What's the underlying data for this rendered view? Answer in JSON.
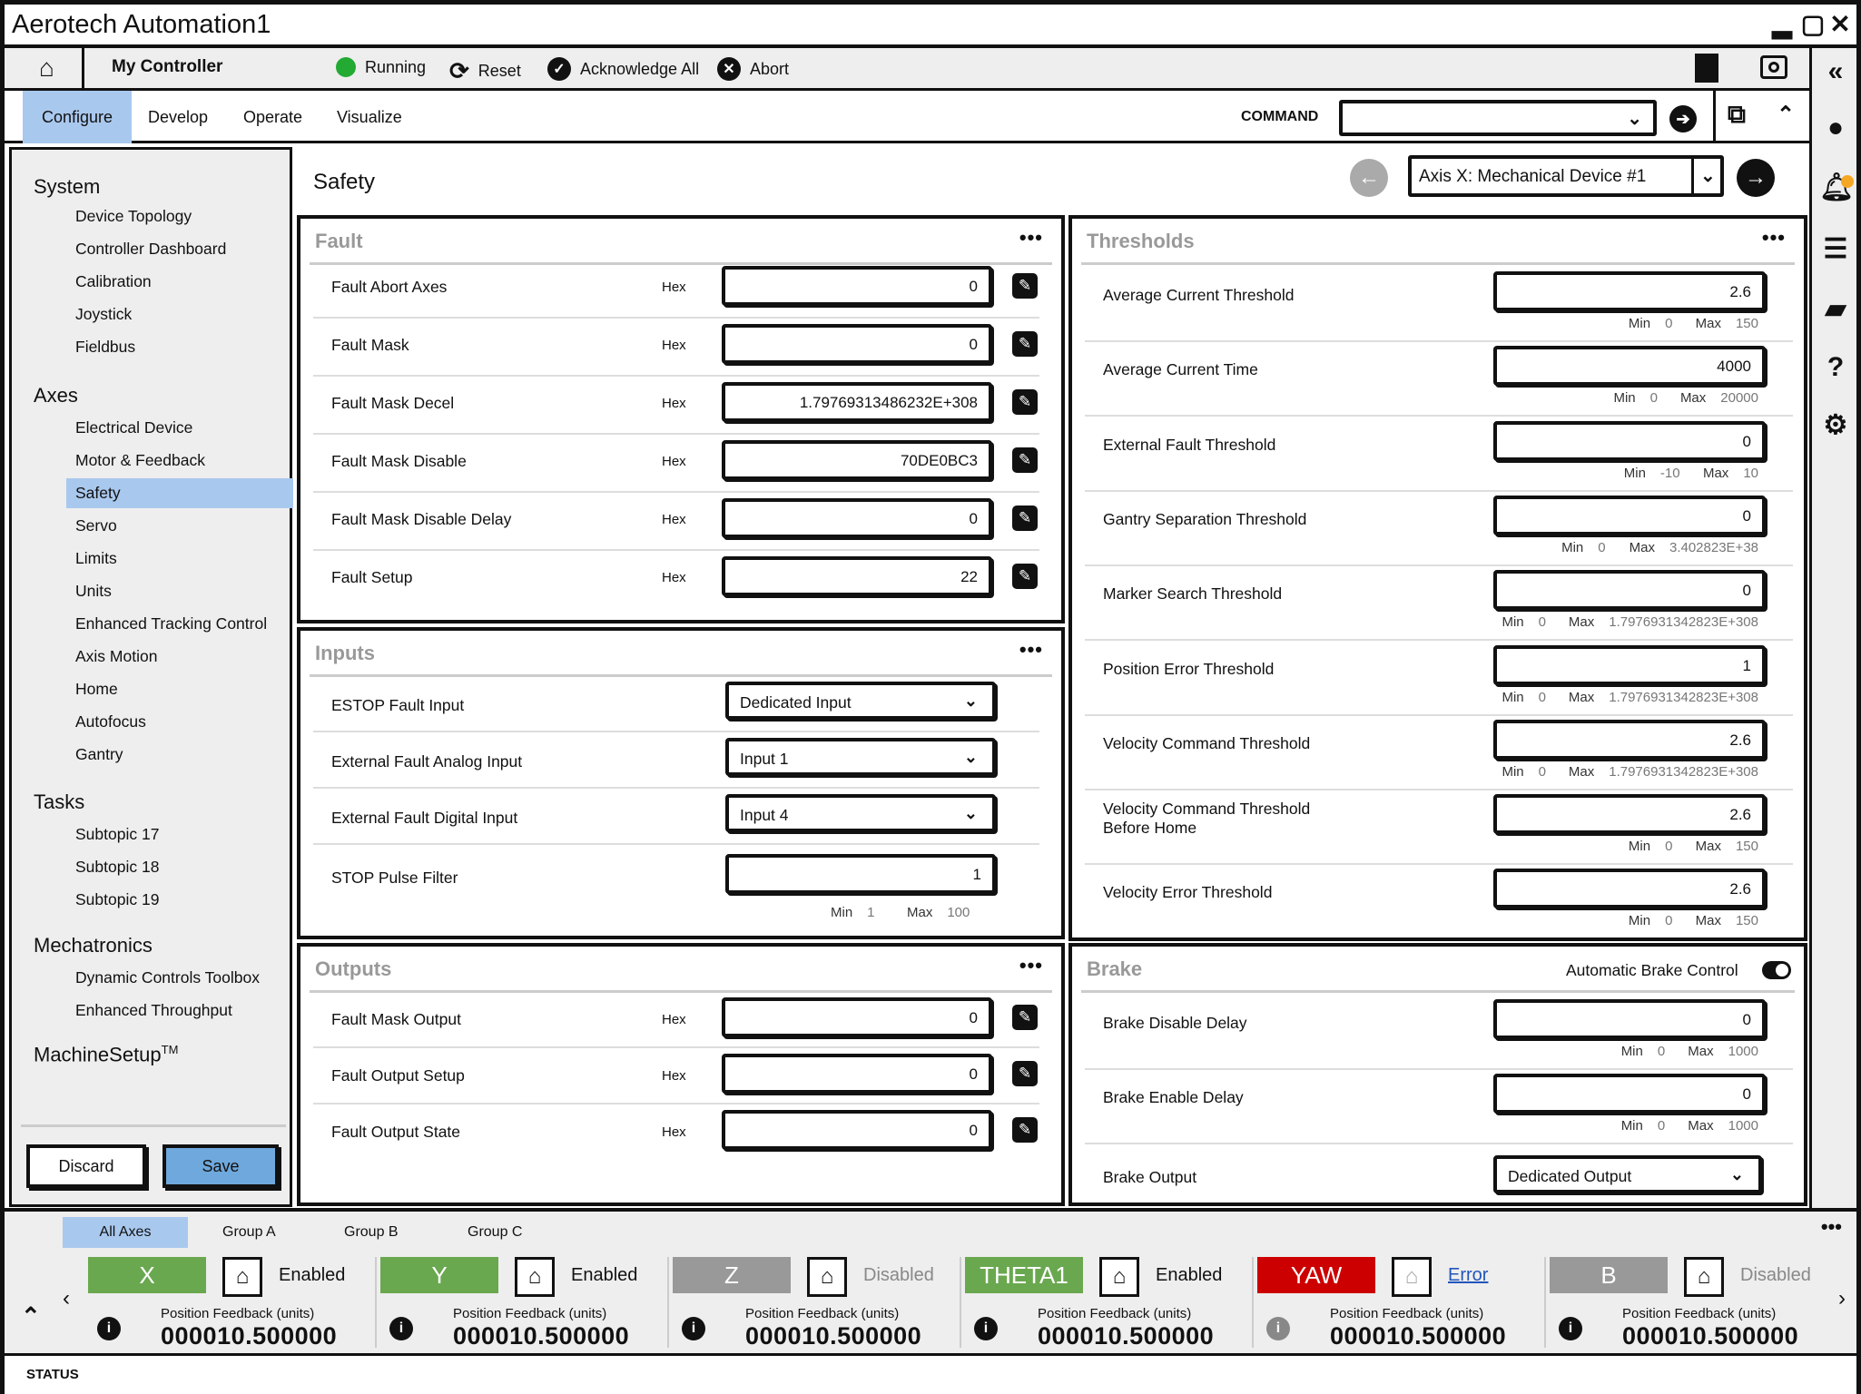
{
  "window": {
    "title": "Aerotech Automation1"
  },
  "toolbar": {
    "controller_name": "My Controller",
    "running_label": "Running",
    "reset_label": "Reset",
    "acknowledge_label": "Acknowledge All",
    "abort_label": "Abort"
  },
  "nav": {
    "tabs": [
      "Configure",
      "Develop",
      "Operate",
      "Visualize"
    ],
    "active_tab": "Configure",
    "command_label": "COMMAND",
    "command_value": ""
  },
  "sidebar": {
    "sections": [
      {
        "title": "System",
        "items": [
          "Device Topology",
          "Controller Dashboard",
          "Calibration",
          "Joystick",
          "Fieldbus"
        ]
      },
      {
        "title": "Axes",
        "items": [
          "Electrical Device",
          "Motor & Feedback",
          "Safety",
          "Servo",
          "Limits",
          "Units",
          "Enhanced Tracking Control",
          "Axis Motion",
          "Home",
          "Autofocus",
          "Gantry"
        ]
      },
      {
        "title": "Tasks",
        "items": [
          "Subtopic 17",
          "Subtopic 18",
          "Subtopic 19"
        ]
      },
      {
        "title": "Mechatronics",
        "items": [
          "Dynamic Controls Toolbox",
          "Enhanced Throughput"
        ]
      }
    ],
    "machine_setup": "MachineSetup",
    "machine_setup_tm": "TM",
    "active_item": "Safety",
    "discard_label": "Discard",
    "save_label": "Save"
  },
  "page": {
    "title": "Safety",
    "axis_select": "Axis X: Mechanical Device #1"
  },
  "fault": {
    "title": "Fault",
    "hex_label": "Hex",
    "rows": [
      {
        "label": "Fault Abort Axes",
        "value": "0"
      },
      {
        "label": "Fault Mask",
        "value": "0"
      },
      {
        "label": "Fault Mask Decel",
        "value": "1.79769313486232E+308"
      },
      {
        "label": "Fault Mask Disable",
        "value": "70DE0BC3"
      },
      {
        "label": "Fault Mask Disable Delay",
        "value": "0"
      },
      {
        "label": "Fault Setup",
        "value": "22"
      }
    ]
  },
  "inputs": {
    "title": "Inputs",
    "rows": [
      {
        "label": "ESTOP Fault Input",
        "value": "Dedicated Input"
      },
      {
        "label": "External Fault Analog Input",
        "value": "Input 1"
      },
      {
        "label": "External Fault Digital Input",
        "value": "Input 4"
      }
    ],
    "stop_pulse": {
      "label": "STOP Pulse Filter",
      "value": "1",
      "min": "1",
      "max": "100"
    },
    "min_label": "Min",
    "max_label": "Max"
  },
  "outputs": {
    "title": "Outputs",
    "hex_label": "Hex",
    "rows": [
      {
        "label": "Fault Mask Output",
        "value": "0"
      },
      {
        "label": "Fault Output Setup",
        "value": "0"
      },
      {
        "label": "Fault Output State",
        "value": "0"
      }
    ]
  },
  "thresholds": {
    "title": "Thresholds",
    "min_label": "Min",
    "max_label": "Max",
    "rows": [
      {
        "label": "Average Current Threshold",
        "value": "2.6",
        "min": "0",
        "max": "150"
      },
      {
        "label": "Average Current Time",
        "value": "4000",
        "min": "0",
        "max": "20000"
      },
      {
        "label": "External Fault Threshold",
        "value": "0",
        "min": "-10",
        "max": "10"
      },
      {
        "label": "Gantry Separation Threshold",
        "value": "0",
        "min": "0",
        "max": "3.402823E+38"
      },
      {
        "label": "Marker Search Threshold",
        "value": "0",
        "min": "0",
        "max": "1.7976931342823E+308"
      },
      {
        "label": "Position Error Threshold",
        "value": "1",
        "min": "0",
        "max": "1.7976931342823E+308"
      },
      {
        "label": "Velocity Command Threshold",
        "value": "2.6",
        "min": "0",
        "max": "1.7976931342823E+308"
      },
      {
        "label": "Velocity Command Threshold",
        "label2": "Before Home",
        "value": "2.6",
        "min": "0",
        "max": "150"
      },
      {
        "label": "Velocity Error Threshold",
        "value": "2.6",
        "min": "0",
        "max": "150"
      }
    ]
  },
  "brake": {
    "title": "Brake",
    "auto_label": "Automatic Brake Control",
    "auto_on": true,
    "min_label": "Min",
    "max_label": "Max",
    "rows": [
      {
        "label": "Brake Disable Delay",
        "value": "0",
        "min": "0",
        "max": "1000"
      },
      {
        "label": "Brake Enable Delay",
        "value": "0",
        "min": "0",
        "max": "1000"
      }
    ],
    "output": {
      "label": "Brake Output",
      "value": "Dedicated Output"
    }
  },
  "axes_bar": {
    "groups": [
      "All Axes",
      "Group A",
      "Group B",
      "Group C"
    ],
    "active_group": "All Axes",
    "pf_label": "Position Feedback (units)",
    "axes": [
      {
        "name": "X",
        "color": "#6aa84f",
        "state": "Enabled",
        "value": "000010.500000"
      },
      {
        "name": "Y",
        "color": "#6aa84f",
        "state": "Enabled",
        "value": "000010.500000"
      },
      {
        "name": "Z",
        "color": "#999999",
        "state": "Disabled",
        "value": "000010.500000"
      },
      {
        "name": "THETA1",
        "color": "#6aa84f",
        "state": "Enabled",
        "value": "000010.500000"
      },
      {
        "name": "YAW",
        "color": "#cc0000",
        "state": "Error",
        "value": "000010.500000"
      },
      {
        "name": "B",
        "color": "#999999",
        "state": "Disabled",
        "value": "000010.500000"
      }
    ]
  },
  "status": {
    "label": "STATUS"
  },
  "colors": {
    "accent": "#a9c8ee",
    "save_button": "#6fa8dc"
  }
}
